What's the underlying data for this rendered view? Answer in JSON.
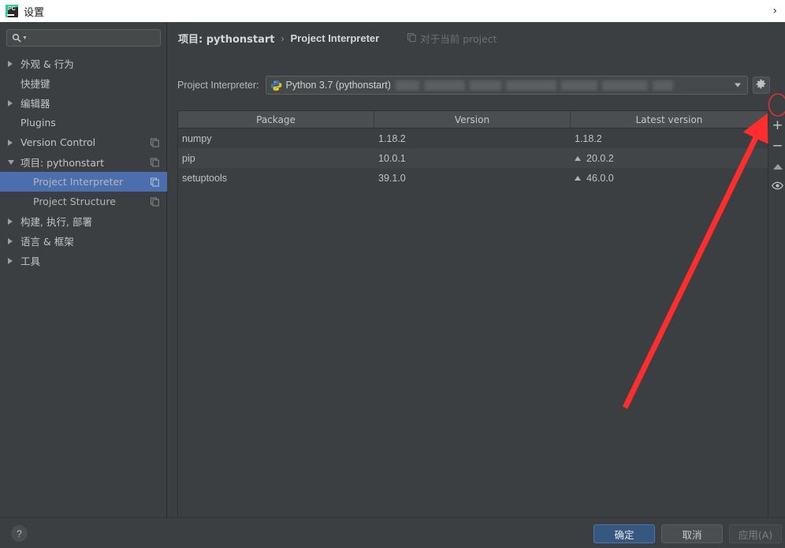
{
  "window": {
    "title": "设置",
    "app_icon": "pycharm-icon",
    "corner_chevron": "›"
  },
  "sidebar": {
    "search": {
      "icon": "search-icon",
      "value": "",
      "placeholder": ""
    },
    "items": [
      {
        "label": "外观 & 行为",
        "twisty": "right",
        "indent": 0,
        "scope_icon": false,
        "selected": false
      },
      {
        "label": "快捷键",
        "twisty": "none",
        "indent": 0,
        "scope_icon": false,
        "selected": false
      },
      {
        "label": "编辑器",
        "twisty": "right",
        "indent": 0,
        "scope_icon": false,
        "selected": false
      },
      {
        "label": "Plugins",
        "twisty": "none",
        "indent": 0,
        "scope_icon": false,
        "selected": false
      },
      {
        "label": "Version Control",
        "twisty": "right",
        "indent": 0,
        "scope_icon": true,
        "selected": false
      },
      {
        "label": "项目: pythonstart",
        "twisty": "down",
        "indent": 0,
        "scope_icon": true,
        "selected": false
      },
      {
        "label": "Project Interpreter",
        "twisty": "none",
        "indent": 1,
        "scope_icon": true,
        "selected": true
      },
      {
        "label": "Project Structure",
        "twisty": "none",
        "indent": 1,
        "scope_icon": true,
        "selected": false
      },
      {
        "label": "构建, 执行, 部署",
        "twisty": "right",
        "indent": 0,
        "scope_icon": false,
        "selected": false
      },
      {
        "label": "语言 & 框架",
        "twisty": "right",
        "indent": 0,
        "scope_icon": false,
        "selected": false
      },
      {
        "label": "工具",
        "twisty": "right",
        "indent": 0,
        "scope_icon": false,
        "selected": false
      }
    ]
  },
  "content": {
    "breadcrumb": {
      "parent": "项目: pythonstart",
      "separator": "›",
      "current": "Project Interpreter",
      "scope_icon": "copy-scope-icon",
      "scope_text": "对于当前 project"
    },
    "interpreter": {
      "label": "Project Interpreter:",
      "value": "Python 3.7 (pythonstart)",
      "path_redacted": true,
      "dropdown_icon": "chevron-down-icon",
      "settings_icon": "gear-icon"
    },
    "packages_table": {
      "columns": [
        "Package",
        "Version",
        "Latest version"
      ],
      "rows": [
        {
          "package": "numpy",
          "version": "1.18.2",
          "latest": "1.18.2",
          "upgradable": false
        },
        {
          "package": "pip",
          "version": "10.0.1",
          "latest": "20.0.2",
          "upgradable": true
        },
        {
          "package": "setuptools",
          "version": "39.1.0",
          "latest": "46.0.0",
          "upgradable": true
        }
      ],
      "upgrade_marker": "▲"
    },
    "toolbar": [
      {
        "name": "add-package-button",
        "glyph": "+",
        "highlighted": true
      },
      {
        "name": "remove-package-button",
        "glyph": "−",
        "highlighted": false
      },
      {
        "name": "upgrade-package-button",
        "glyph": "▲",
        "highlighted": false
      },
      {
        "name": "show-early-releases-button",
        "glyph": "eye",
        "highlighted": false
      }
    ]
  },
  "footer": {
    "help_label": "?",
    "ok_label": "确定",
    "cancel_label": "取消",
    "apply_label": "应用(A)"
  },
  "annotation": {
    "arrow_color": "#ff2d2d",
    "ellipse_color": "#e03030",
    "target": "add-package-button"
  },
  "colors": {
    "background": "#3c3f41",
    "selection": "#4b6eaf",
    "primary_button": "#365880",
    "titlebar": "#ffffff"
  }
}
